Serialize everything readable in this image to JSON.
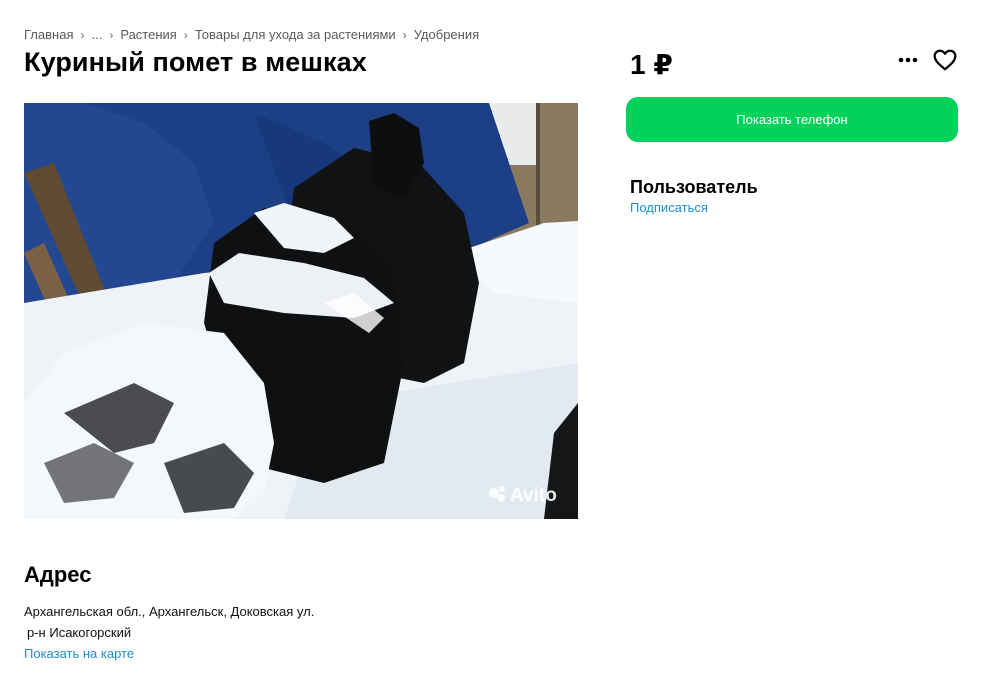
{
  "breadcrumb": {
    "items": [
      "Главная",
      "...",
      "Растения",
      "Товары для ухода за растениями",
      "Удобрения"
    ]
  },
  "listing": {
    "title": "Куриный помет в мешках",
    "price": "1 ₽",
    "image_watermark": "Avito"
  },
  "actions": {
    "show_phone_label": "Показать телефон",
    "more_icon": "more-dots-icon",
    "favorite_icon": "heart-icon"
  },
  "seller": {
    "name": "Пользователь",
    "subscribe_label": "Подписаться"
  },
  "address": {
    "heading": "Адрес",
    "line": "Архангельская обл., Архангельск, Доковская ул.",
    "district": "р-н Исакогорский",
    "map_link": "Показать на карте"
  },
  "colors": {
    "accent_green": "#02d15c",
    "link_blue": "#1b8fcf"
  }
}
